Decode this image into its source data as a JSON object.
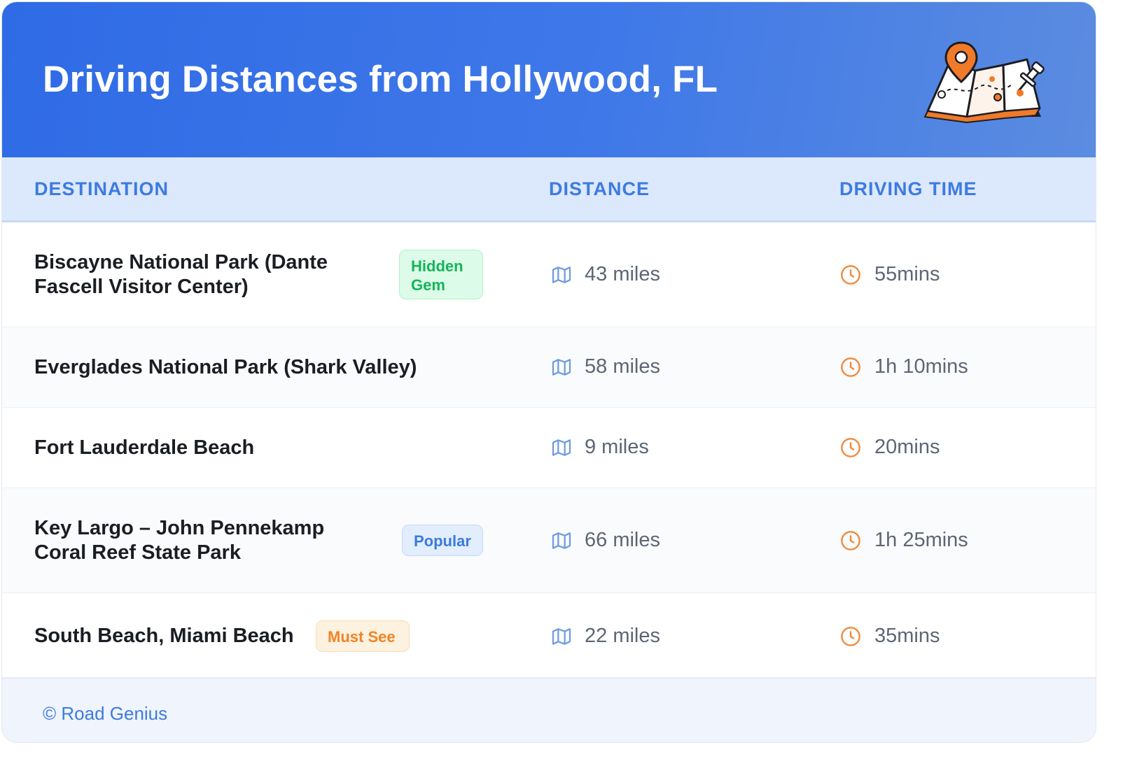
{
  "header": {
    "title": "Driving Distances from Hollywood, FL",
    "illustration": "map-with-pins-icon"
  },
  "table": {
    "columns": [
      "DESTINATION",
      "DISTANCE",
      "DRIVING TIME"
    ],
    "rows": [
      {
        "destination": [
          "Biscayne National Park (Dante",
          "Fascell Visitor Center)"
        ],
        "badge": [
          "Hidden",
          "Gem"
        ],
        "distance": "43 miles",
        "time": "55mins"
      },
      {
        "destination": [
          "Everglades National Park (Shark Valley)"
        ],
        "badge": null,
        "distance": "58 miles",
        "time": "1h 10mins"
      },
      {
        "destination": [
          "Fort Lauderdale Beach"
        ],
        "badge": null,
        "distance": "9 miles",
        "time": "20mins"
      },
      {
        "destination": [
          "Key Largo – John Pennekamp",
          "Coral Reef State Park"
        ],
        "badge": [
          "Popular"
        ],
        "distance": "66 miles",
        "time": "1h 25mins"
      },
      {
        "destination": [
          "South Beach, Miami Beach"
        ],
        "badge": [
          "Must See"
        ],
        "distance": "22 miles",
        "time": "35mins"
      }
    ]
  },
  "footer": {
    "credit": "© Road Genius"
  },
  "colors": {
    "header_blue": "#2f6be6",
    "accent_blue": "#3d7be0",
    "clock_orange": "#f08a3c",
    "badge_green": "#16b45a",
    "badge_orange": "#f08426"
  },
  "icons": {
    "distance": "map-icon",
    "time": "clock-icon"
  }
}
